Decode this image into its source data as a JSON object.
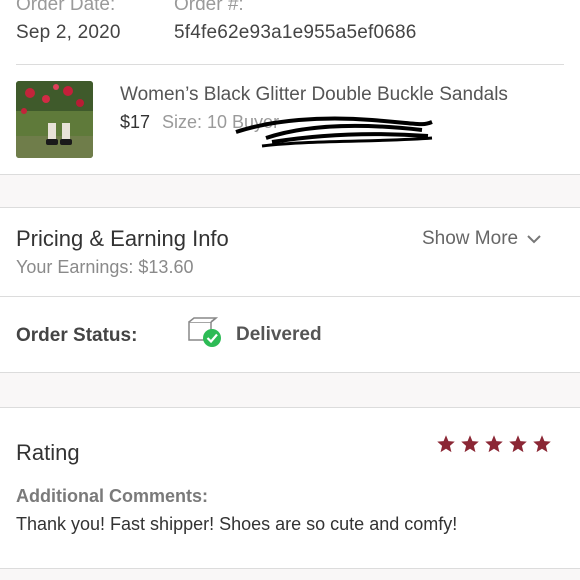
{
  "order": {
    "date_label": "Order Date:",
    "date_value": "Sep 2, 2020",
    "number_label": "Order #:",
    "number_value": "5f4fe62e93a1e955a5ef0686"
  },
  "item": {
    "title": "Women’s Black Glitter Double Buckle Sandals",
    "price": "$17",
    "size": "Size: 10  Buyer"
  },
  "pricing": {
    "title": "Pricing & Earning Info",
    "earnings": "Your Earnings: $13.60",
    "show_more": "Show More"
  },
  "status": {
    "label": "Order Status:",
    "value": "Delivered",
    "icon": "delivered-box-icon"
  },
  "rating": {
    "label": "Rating",
    "stars": 5,
    "star_color": "#8b2735",
    "comments_label": "Additional Comments:",
    "comments": "Thank you! Fast shipper! Shoes are so cute and comfy!"
  }
}
